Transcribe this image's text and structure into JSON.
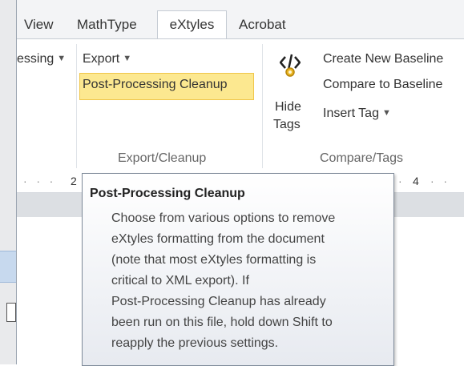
{
  "tabs": [
    {
      "label": "View"
    },
    {
      "label": "MathType"
    },
    {
      "label": "eXtyles"
    },
    {
      "label": "Acrobat"
    }
  ],
  "ribbon": {
    "processing_label": "essing",
    "export_label": "Export",
    "cleanup_label": "Post-Processing Cleanup",
    "hide_tags_line1": "Hide",
    "hide_tags_line2": "Tags",
    "create_baseline": "Create New Baseline",
    "compare_baseline": "Compare to Baseline",
    "insert_tag": "Insert Tag",
    "group_export": "Export/Cleanup",
    "group_compare": "Compare/Tags"
  },
  "ruler": {
    "left": "2",
    "right": "4"
  },
  "tooltip": {
    "title": "Post-Processing Cleanup",
    "lines": [
      "Choose from various options to remove",
      "eXtyles formatting from the document",
      "(note that most eXtyles formatting is",
      "critical to XML export). If",
      "Post-Processing Cleanup has already",
      "been run on this file, hold down Shift to",
      "reapply the previous settings."
    ]
  },
  "colors": {
    "highlight": "#fce890",
    "tooltip_border": "#7e8a99",
    "ribbon_bg": "#ffffff"
  }
}
